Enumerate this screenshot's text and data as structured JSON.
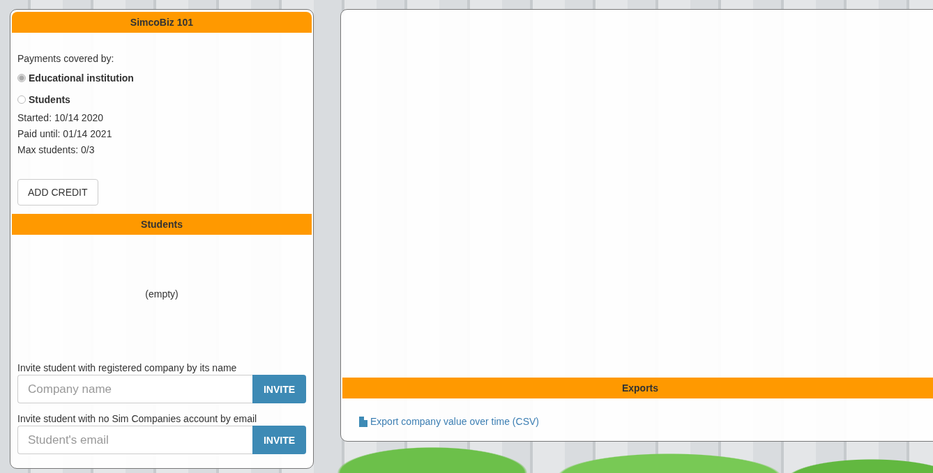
{
  "course": {
    "title": "SimcoBiz 101",
    "payments_label": "Payments covered by:",
    "payment_options": [
      {
        "label": "Educational institution",
        "selected": true
      },
      {
        "label": "Students",
        "selected": false
      }
    ],
    "details": [
      "Started: 10/14 2020",
      "Paid until: 01/14 2021",
      "Max students: 0/3"
    ],
    "add_credit_button": "ADD CREDIT"
  },
  "students": {
    "title": "Students",
    "empty_text": "(empty)",
    "invites": [
      {
        "label": "Invite student with registered company by its name",
        "placeholder": "Company name",
        "button": "INVITE"
      },
      {
        "label": "Invite student with no Sim Companies account by email",
        "placeholder": "Student's email",
        "button": "INVITE"
      }
    ]
  },
  "exports": {
    "title": "Exports",
    "links": [
      {
        "label": "Export company value over time (CSV)"
      }
    ]
  }
}
